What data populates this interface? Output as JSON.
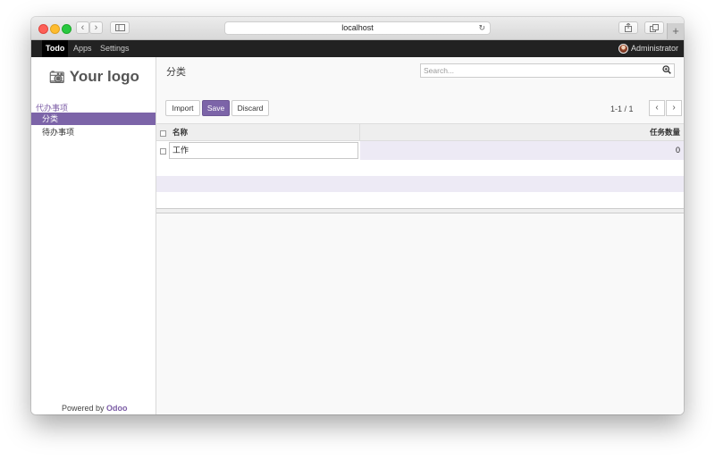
{
  "browser": {
    "url": "localhost",
    "reload_icon": "reload-icon",
    "back_icon": "chevron-left-icon",
    "forward_icon": "chevron-right-icon",
    "sidebar_icon": "sidebar-icon",
    "share_icon": "share-icon",
    "tabs_icon": "tabs-icon",
    "new_tab": "+"
  },
  "navbar": {
    "items": [
      "Todo",
      "Apps",
      "Settings"
    ],
    "user": "Administrator"
  },
  "sidebar": {
    "logo_text": "Your logo",
    "section": "代办事项",
    "items": [
      "分类",
      "待办事项"
    ],
    "powered_prefix": "Powered by",
    "powered_brand": "Odoo"
  },
  "main": {
    "breadcrumb": "分类",
    "buttons": {
      "import": "Import",
      "save": "Save",
      "discard": "Discard"
    },
    "search_placeholder": "Search...",
    "pager": "1-1 / 1",
    "columns": [
      "名称",
      "任务数量"
    ],
    "rows": [
      {
        "name": "工作",
        "count": "0"
      }
    ]
  },
  "colors": {
    "accent": "#7c64a8",
    "navbar": "#222222"
  }
}
